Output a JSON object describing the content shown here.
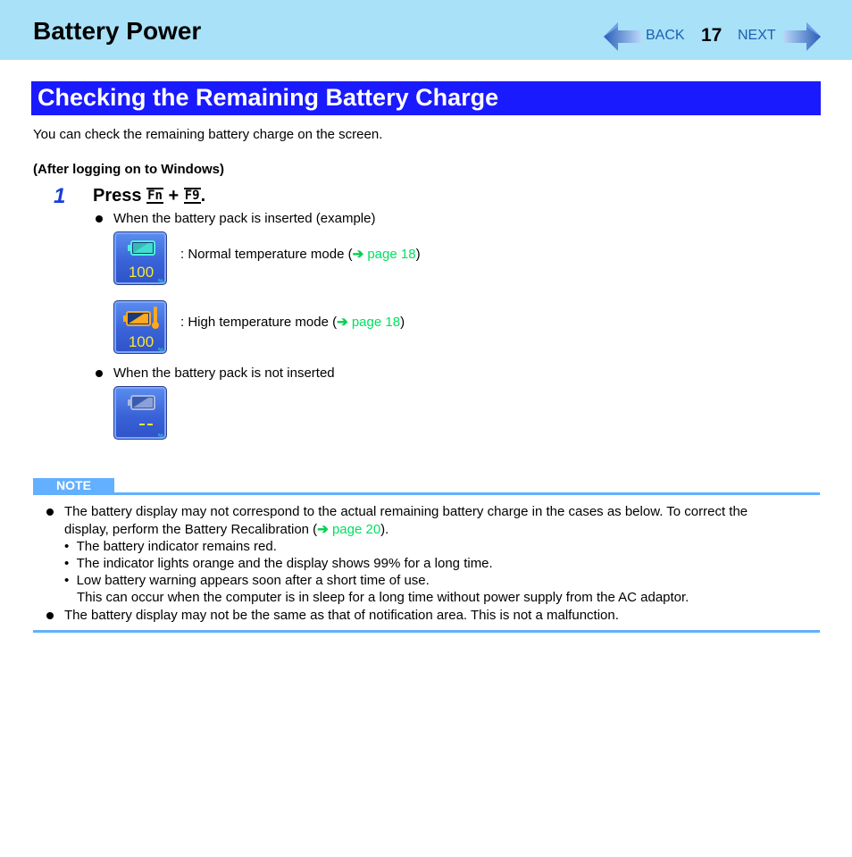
{
  "header": {
    "title": "Battery Power",
    "nav": {
      "back_label": "BACK",
      "page_number": "17",
      "next_label": "NEXT"
    }
  },
  "section": {
    "title": "Checking the Remaining Battery Charge",
    "intro": "You can check the remaining battery charge on the screen.",
    "subheading": "(After logging on to Windows)"
  },
  "step": {
    "number": "1",
    "press_label": "Press",
    "key1": "Fn",
    "plus": "+",
    "key2": "F9",
    "period": ".",
    "bullets": [
      "When the battery pack is inserted (example)",
      "When the battery pack is not inserted"
    ],
    "icons": [
      {
        "icon": "battery-normal-temp-icon",
        "value_text": "100",
        "unit": "%",
        "mode_prefix": ": Normal temperature mode (",
        "link_arrow": "➔",
        "link_text": "page 18",
        "mode_suffix": ")"
      },
      {
        "icon": "battery-high-temp-icon",
        "value_text": "100",
        "unit": "%",
        "mode_prefix": ": High temperature mode (",
        "link_arrow": "➔",
        "link_text": "page 18",
        "mode_suffix": ")"
      },
      {
        "icon": "battery-not-inserted-icon",
        "value_text": "- -",
        "unit": "%"
      }
    ]
  },
  "note": {
    "label": "NOTE",
    "item1_line1": "The battery display may not correspond to the actual remaining battery charge in the cases as below. To correct the",
    "item1_line2_prefix": "display, perform the Battery Recalibration (",
    "item1_link_arrow": "➔",
    "item1_link_text": "page 20",
    "item1_line2_suffix": ").",
    "sub_items": [
      "The battery indicator remains red.",
      "The indicator lights orange and the display shows 99% for a long time.",
      "Low battery warning appears soon after a short time of use."
    ],
    "sub_item3_continuation": "This can occur when the computer is in sleep for a long time without power supply from the AC adaptor.",
    "item2": "The battery display may not be the same as that of notification area. This is not a malfunction."
  },
  "colors": {
    "header_bg": "#a9e1f8",
    "section_title_bg": "#1a1aff",
    "link": "#00e060",
    "note_accent": "#62b0ff",
    "step_number": "#1a3fd8"
  }
}
